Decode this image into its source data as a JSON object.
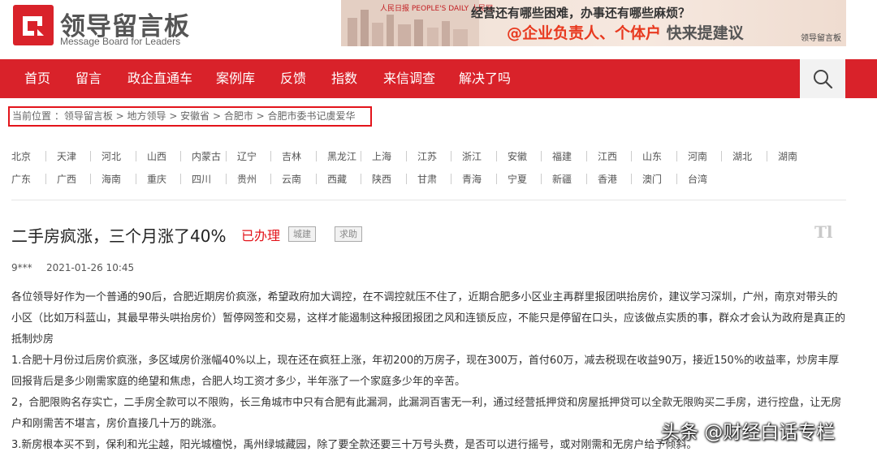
{
  "header": {
    "logo_title": "领导留言板",
    "logo_subtitle": "Message Board for Leaders",
    "brand_color": "#d9222a"
  },
  "banner": {
    "publishers": "人民日报  PEOPLE'S DAILY   人民网",
    "line1": "经营还有哪些困难，办事还有哪些麻烦？",
    "line2_highlight": "@企业负责人、个体户",
    "line2_rest": " 快来提建议",
    "brand": "领导留言板"
  },
  "nav": {
    "items": [
      "首页",
      "留言",
      "政企直通车",
      "案例库",
      "反馈",
      "指数",
      "来信调查",
      "解决了吗"
    ],
    "search_icon": "search-icon"
  },
  "breadcrumb": {
    "text": "当前位置 ：领导留言板 > 地方领导 > 安徽省 > 合肥市 > 合肥市委书记虞爱华"
  },
  "provinces": {
    "row1": [
      "北京",
      "天津",
      "河北",
      "山西",
      "内蒙古",
      "辽宁",
      "吉林",
      "黑龙江",
      "上海",
      "江苏",
      "浙江",
      "安徽",
      "福建",
      "江西",
      "山东",
      "河南",
      "湖北",
      "湖南"
    ],
    "row2": [
      "广东",
      "广西",
      "海南",
      "重庆",
      "四川",
      "贵州",
      "云南",
      "西藏",
      "陕西",
      "甘肃",
      "青海",
      "宁夏",
      "新疆",
      "香港",
      "澳门",
      "台湾"
    ]
  },
  "article": {
    "title": "二手房疯涨，三个月涨了40%",
    "status": "已办理",
    "tags": [
      "城建",
      "求助"
    ],
    "font_toggle": "Tl",
    "user": "9***",
    "time": "2021-01-26 10:45",
    "paragraphs": [
      "各位领导好作为一个普通的90后，合肥近期房价疯涨，希望政府加大调控，在不调控就压不住了，近期合肥多小区业主再群里报团哄抬房价，建议学习深圳，广州，南京对带头的小区（比如万科蓝山，其最早带头哄抬房价）暂停网签和交易，这样才能遏制这种报团报团之风和连锁反应，不能只是停留在口头，应该做点实质的事，群众才会认为政府是真正的抵制炒房",
      "1.合肥十月份过后房价疯涨，多区域房价涨幅40%以上，现在还在疯狂上涨，年初200的万房子，现在300万，首付60万，减去税现在收益90万，接近150%的收益率，炒房丰厚回报背后是多少刚需家庭的绝望和焦虑，合肥人均工资才多少，半年涨了一个家庭多少年的辛苦。",
      "2，合肥限购名存实亡，二手房全款可以不限购，长三角城市中只有合肥有此漏洞，此漏洞百害无一利，通过经营抵押贷和房屋抵押贷可以全款无限购买二手房，进行控盘，让无房户和刚需苦不堪言，房价直接几十万的跳涨。",
      "3.新房根本买不到，保利和光尘越，阳光城檀悦，禹州绿城藏园，除了要全款还要三十万号头费，是否可以进行摇号，或对刚需和无房户给予倾斜。"
    ]
  },
  "watermark": "头条 @财经白话专栏"
}
